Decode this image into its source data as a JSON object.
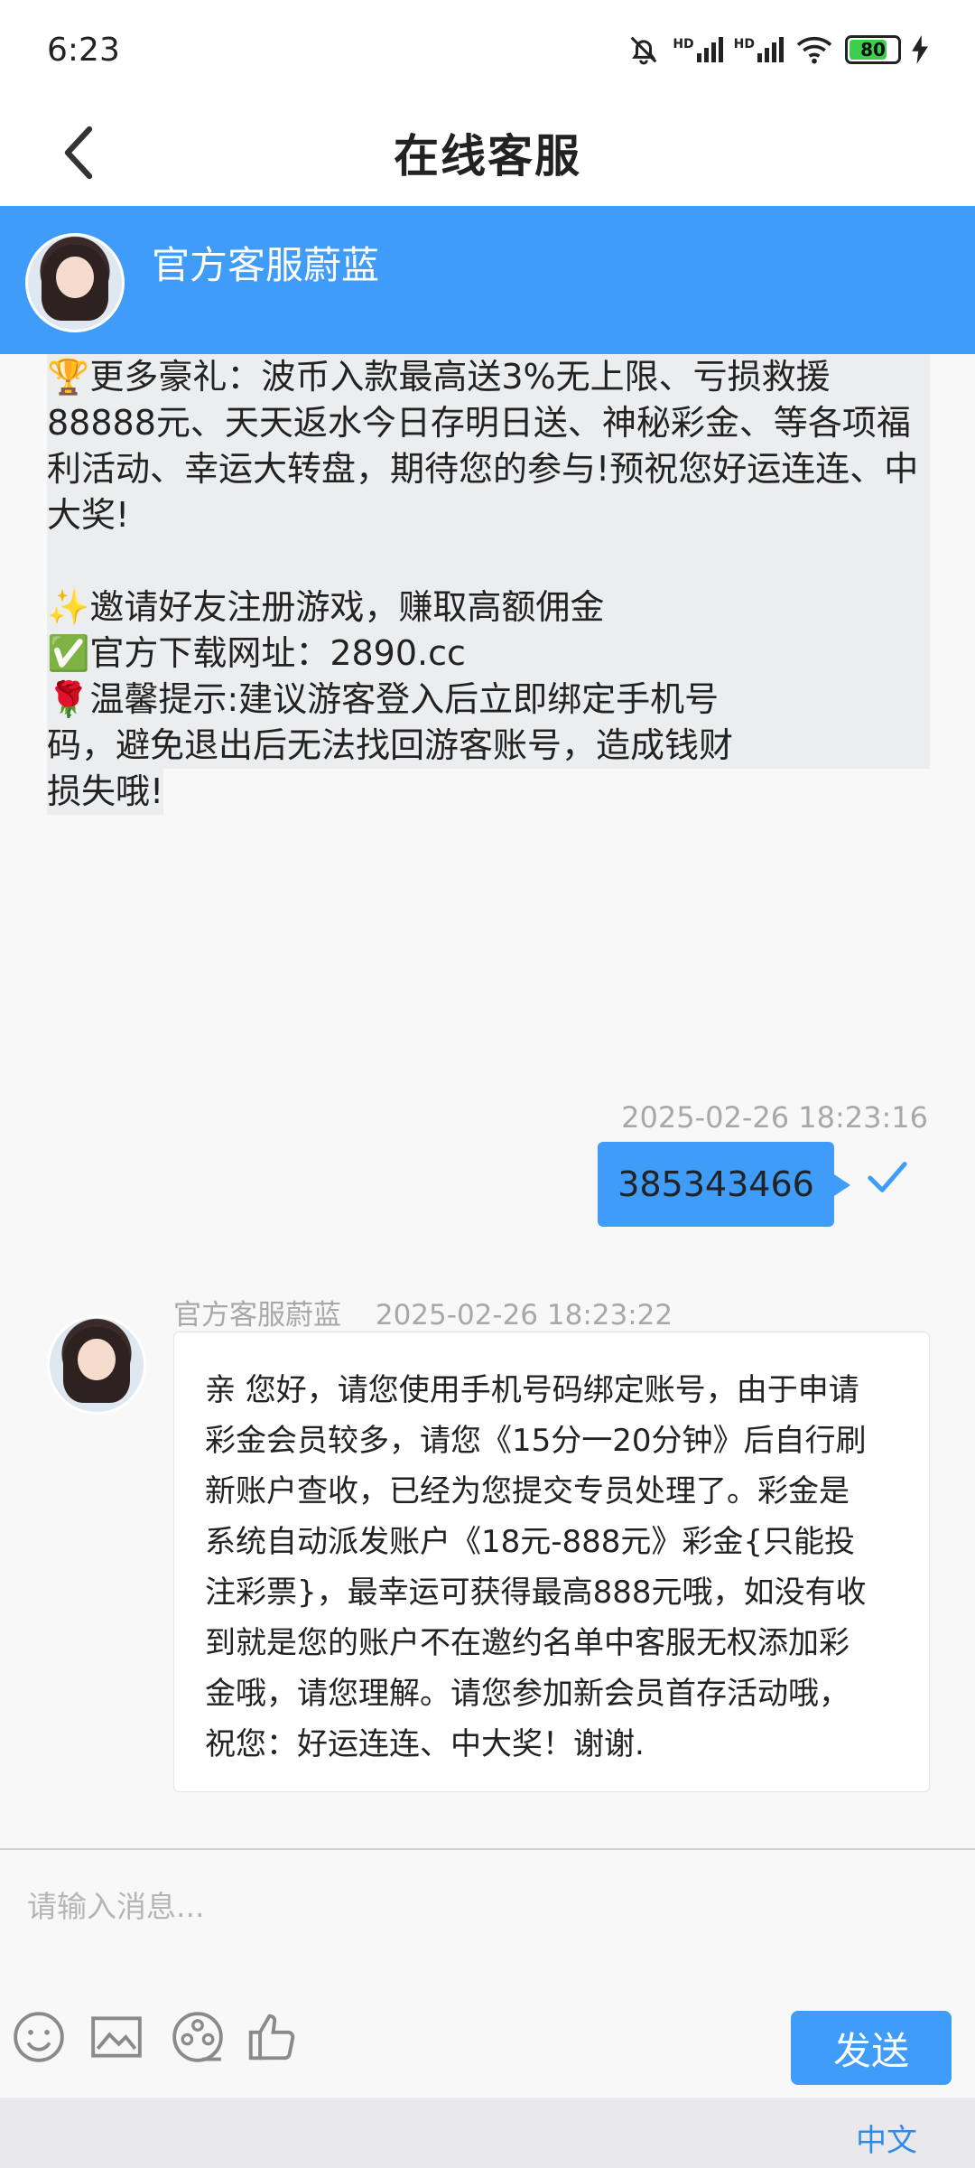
{
  "status_bar": {
    "time": "6:23",
    "battery": 80,
    "battery_label": "80",
    "signal_1": "HD",
    "signal_2": "HD"
  },
  "header": {
    "title": "在线客服"
  },
  "agent": {
    "name": "官方客服蔚蓝"
  },
  "promo": {
    "lines": [
      "🏆更多豪礼：波币入款最高送3%无上限、亏损救援",
      "88888元、天天返水今日存明日送、神秘彩金、等各项福",
      "利活动、幸运大转盘，期待您的参与!预祝您好运连连、中",
      "大奖!",
      "",
      "✨邀请好友注册游戏，赚取高额佣金",
      "  ✅官方下载网址：2890.cc",
      "🌹温馨提示:建议游客登入后立即绑定手机号",
      "码，避免退出后无法找回游客账号，造成钱财",
      "损失哦!"
    ]
  },
  "outgoing_message": {
    "timestamp": "2025-02-26 18:23:16",
    "text": "385343466",
    "status": "read"
  },
  "incoming_message": {
    "sender": "官方客服蔚蓝",
    "timestamp": "2025-02-26 18:23:22",
    "lines": [
      "亲 您好，请您使用手机号码绑定账号，由于申请",
      "彩金会员较多，请您《15分一20分钟》后自行刷",
      "新账户查收，已经为您提交专员处理了。彩金是",
      "系统自动派发账户《18元-888元》彩金{只能投",
      "注彩票}，最幸运可获得最高888元哦，如没有收",
      "到就是您的账户不在邀约名单中客服无权添加彩",
      "金哦，请您理解。请您参加新会员首存活动哦，",
      "祝您：好运连连、中大奖！谢谢."
    ]
  },
  "composer": {
    "placeholder": "请输入消息...",
    "send_label": "发送",
    "toolbar_icons": [
      "emoji-icon",
      "image-icon",
      "video-icon",
      "thumbs-up-icon"
    ]
  },
  "footer": {
    "language": "中文"
  },
  "colors": {
    "accent": "#3f9cf8",
    "link": "#2f8be6",
    "timestamp": "#a8a8a8"
  }
}
